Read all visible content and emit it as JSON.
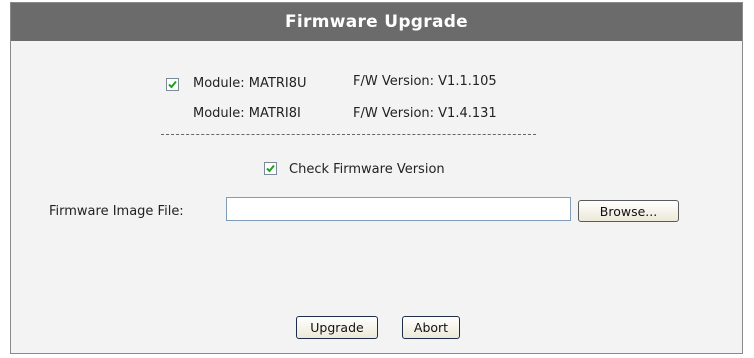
{
  "dialog": {
    "title": "Firmware Upgrade"
  },
  "modules": [
    {
      "checked": true,
      "module_label": "Module: MATRI8U",
      "version_label": "F/W Version: V1.1.105"
    },
    {
      "module_label": "Module: MATRI8I",
      "version_label": "F/W Version: V1.4.131"
    }
  ],
  "separator": "------------------------------------------------------------",
  "check_firmware": {
    "checked": true,
    "label": "Check Firmware Version"
  },
  "file": {
    "label": "Firmware Image File:",
    "value": "",
    "browse_label": "Browse..."
  },
  "actions": {
    "upgrade_label": "Upgrade",
    "abort_label": "Abort"
  },
  "colors": {
    "title_bg": "#6b6b6b",
    "panel_bg": "#f3f3f3",
    "check_green": "#21a121"
  }
}
